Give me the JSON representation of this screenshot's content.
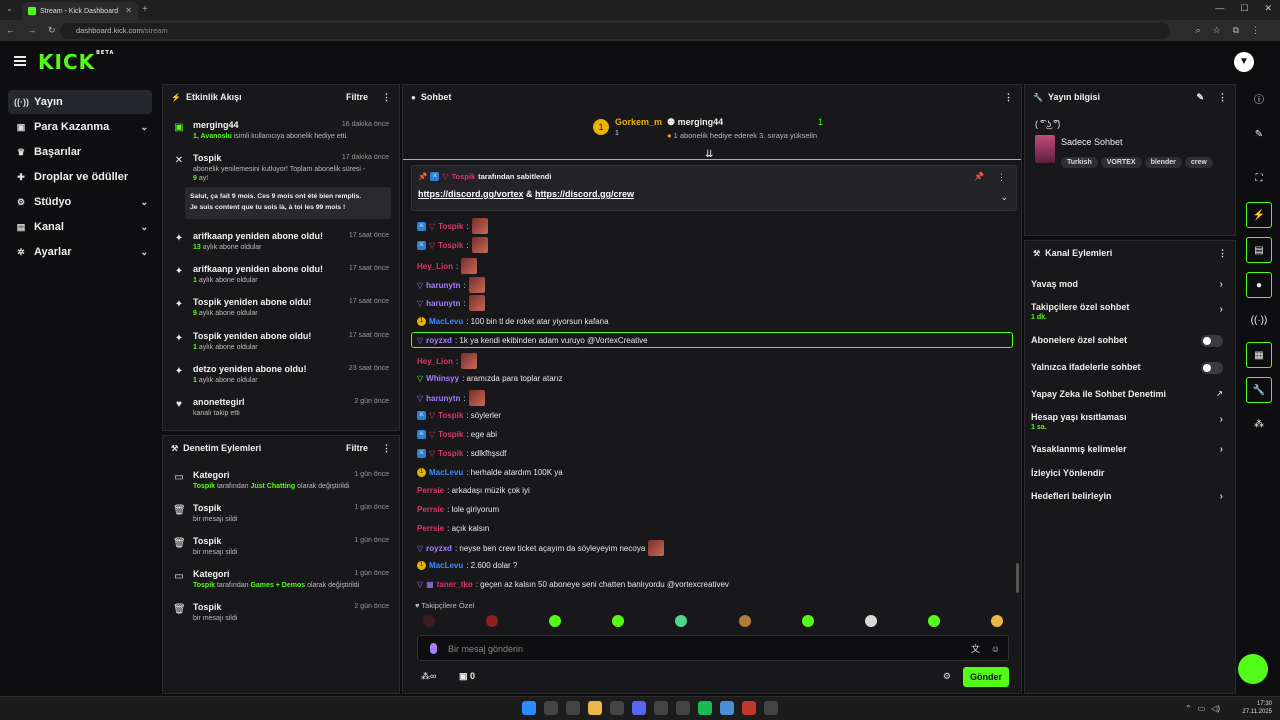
{
  "browser": {
    "tab_title": "Stream - Kick Dashboard",
    "url_domain": "dashboard.kick.com",
    "url_path": "/stream"
  },
  "brand": {
    "logo": "KICK",
    "beta": "BETA",
    "accent": "#53fc18"
  },
  "nav": {
    "items": [
      {
        "label": "Yayın",
        "icon": "broadcast-icon"
      },
      {
        "label": "Para Kazanma",
        "icon": "wallet-icon"
      },
      {
        "label": "Başarılar",
        "icon": "trophy-icon"
      },
      {
        "label": "Droplar ve ödüller",
        "icon": "gift-icon"
      },
      {
        "label": "Stüdyo",
        "icon": "studio-icon"
      },
      {
        "label": "Kanal",
        "icon": "channel-icon"
      },
      {
        "label": "Ayarlar",
        "icon": "gear-icon"
      }
    ]
  },
  "activity": {
    "title": "Etkinlik Akışı",
    "filter": "Filtre",
    "items": [
      {
        "title": "merging44",
        "time": "16 dakika önce",
        "sub_strong": "1, Avanoslu",
        "sub": " isimli kullanıcıya abonelik hediye etti."
      },
      {
        "title": "Tospik",
        "time": "17 dakika önce",
        "sub": "abonelik yenilemesini kutluyor! Toplam abonelik süresi -",
        "sub2_strong": "9",
        "sub2": " ay!"
      },
      {
        "title": "arifkaanp yeniden abone oldu!",
        "time": "17 saat önce",
        "sub_strong": "13",
        "sub": " aylık abone oldular"
      },
      {
        "title": "arifkaanp yeniden abone oldu!",
        "time": "17 saat önce",
        "sub_strong": "1",
        "sub": " aylık abone oldular"
      },
      {
        "title": "Tospik yeniden abone oldu!",
        "time": "17 saat önce",
        "sub_strong": "9",
        "sub": " aylık abone oldular"
      },
      {
        "title": "Tospik yeniden abone oldu!",
        "time": "17 saat önce",
        "sub_strong": "1",
        "sub": " aylık abone oldular"
      },
      {
        "title": "detzo yeniden abone oldu!",
        "time": "23 saat önce",
        "sub_strong": "1",
        "sub": " aylık abone oldular"
      },
      {
        "title": "anonettegirl",
        "time": "2 gün önce",
        "sub": "kanalı takip etti"
      }
    ],
    "message_line1": "Salut, ça fait 9 mois. Ces 9 mois ont été bien remplis.",
    "message_line2": "Je suis content que tu sois là, à toi les 99 mois !"
  },
  "moderation": {
    "title": "Denetim Eylemleri",
    "filter": "Filtre",
    "items": [
      {
        "title": "Kategori",
        "time": "1 gün önce",
        "user": "Tospik",
        "mid": " tarafından ",
        "cat": "Just Chatting",
        "end": " olarak değiştirildi"
      },
      {
        "title": "Tospik",
        "time": "1 gün önce",
        "sub": "bir mesajı sildi"
      },
      {
        "title": "Tospik",
        "time": "1 gün önce",
        "sub": "bir mesajı sildi"
      },
      {
        "title": "Kategori",
        "time": "1 gün önce",
        "user": "Tospik",
        "mid": " tarafından ",
        "cat": "Games + Demos",
        "end": " olarak değiştirildi"
      },
      {
        "title": "Tospik",
        "time": "2 gün önce",
        "sub": "bir mesajı sildi"
      }
    ]
  },
  "chat": {
    "title": "Sohbet",
    "gifter1": "Gorkem_m",
    "gifter1_count": "1",
    "gifter2": "merging44",
    "gifter2_count": "1",
    "gift_note": "1 abonelik hediye ederek 3. sıraya yükselin",
    "pinned_by": "Tospik",
    "pinned_label": " tarafından sabitlendi",
    "pinned_link1": "https://discord.gg/vortex",
    "pinned_amp": " & ",
    "pinned_link2": "https://discord.gg/crew",
    "lines": [
      {
        "user": "Tospik",
        "text": ":",
        "emote": true
      },
      {
        "user": "Tospik",
        "text": ":",
        "emote": true
      },
      {
        "user": "Hey_Lion",
        "text": ":",
        "emote": true
      },
      {
        "user": "harunytn",
        "text": ":",
        "emote": true
      },
      {
        "user": "harunytn",
        "text": ":",
        "emote": true
      },
      {
        "user": "MacLevu",
        "text": ": 100 bin tl de roket atar yiyorsun kafana"
      },
      {
        "user": "royzxd",
        "text": ": 1k ya kendi ekibinden adam vuruyo @VortexCreative"
      },
      {
        "user": "Hey_Lion",
        "text": ":",
        "emote": true
      },
      {
        "user": "Whinsyy",
        "text": ": aramızda para toplar atarız"
      },
      {
        "user": "harunytn",
        "text": ":",
        "emote": true
      },
      {
        "user": "Tospik",
        "text": ": söylerler"
      },
      {
        "user": "Tospik",
        "text": ": ege abi"
      },
      {
        "user": "Tospik",
        "text": ": sdlkfhşsdf"
      },
      {
        "user": "MacLevu",
        "text": ": herhalde atardım 100K ya"
      },
      {
        "user": "Perrsie",
        "text": ": arkadaşı müzik çok iyi"
      },
      {
        "user": "Perrsie",
        "text": ": lole giriyorum"
      },
      {
        "user": "Perrsie",
        "text": ": açık kalsın"
      },
      {
        "user": "royzxd",
        "text": ": neyse ben crew ticket açayım da söyleyeyim necoya",
        "emote": true
      },
      {
        "user": "MacLevu",
        "text": ": 2.600 dolar ?"
      },
      {
        "user": "taner_tko",
        "text": ": geçen az kalsın 50 aboneye seni chatten banlıyordu @vortexcreativev"
      }
    ],
    "followers_only": "Takipçilere Özel",
    "input_placeholder": "Bir mesaj gönderin",
    "points": "0",
    "send": "Gönder"
  },
  "stream_info": {
    "title": "Yayın bilgisi",
    "stream_title": "( ͡° ͜ʖ ͡°)",
    "category": "Sadece Sohbet",
    "tags": [
      "Turkish",
      "VORTEX",
      "blender",
      "crew"
    ]
  },
  "channel_actions": {
    "title": "Kanal Eylemleri",
    "items": [
      {
        "label": "Yavaş mod",
        "type": "chevron"
      },
      {
        "label": "Takipçilere özel sohbet",
        "sub": "1 dk.",
        "type": "chevron"
      },
      {
        "label": "Abonelere özel sohbet",
        "type": "toggle"
      },
      {
        "label": "Yalnızca ifadelerle sohbet",
        "type": "toggle"
      },
      {
        "label": "Yapay Zeka ile Sohbet Denetimi",
        "type": "external"
      },
      {
        "label": "Hesap yaşı kısıtlaması",
        "sub": "1 sa.",
        "type": "chevron"
      },
      {
        "label": "Yasaklanmış kelimeler",
        "type": "chevron"
      },
      {
        "label": "İzleyici Yönlendir",
        "type": "none"
      },
      {
        "label": "Hedefleri belirleyin",
        "type": "chevron"
      }
    ]
  },
  "taskbar": {
    "time": "17:30",
    "date": "27.11.2025"
  }
}
